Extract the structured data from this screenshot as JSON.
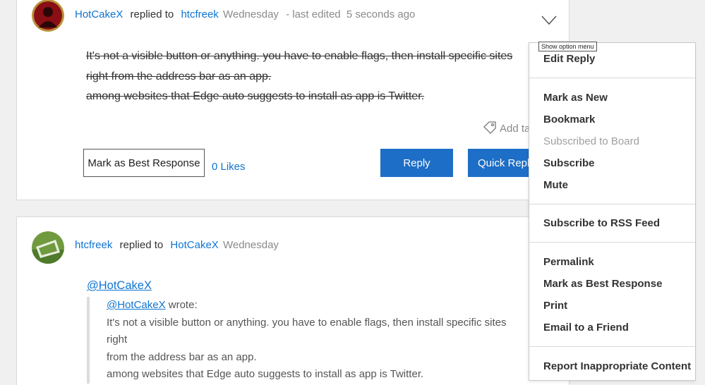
{
  "post1": {
    "author": "HotCakeX",
    "verb": "replied to",
    "reply_to": "htcfreek",
    "date": "Wednesday",
    "edited": "- last edited",
    "edited_time": "5 seconds ago",
    "body_lines": [
      "It's not a visible button or anything. you have to enable flags, then install specific sites",
      "right from the address bar as an app.",
      "among websites that Edge auto suggests to install as app is Twitter."
    ],
    "add_tag": "Add ta",
    "mark_best": "Mark as Best Response",
    "likes": "0 Likes",
    "reply": "Reply",
    "quick_reply": "Quick Reply"
  },
  "post2": {
    "author": "htcfreek",
    "verb": "replied to",
    "reply_to": "HotCakeX",
    "date": "Wednesday",
    "mention": "@HotCakeX",
    "quote_author": "@HotCakeX",
    "quote_wrote": "wrote:",
    "quote_lines": [
      "It's not a visible button or anything. you have to enable flags, then install specific sites right",
      "from the address bar as an app.",
      "among websites that Edge auto suggests to install as app is Twitter."
    ]
  },
  "tooltip": "Show option menu",
  "menu": {
    "items": [
      {
        "label": "Edit Reply",
        "disabled": false
      },
      {
        "label": "Mark as New",
        "disabled": false
      },
      {
        "label": "Bookmark",
        "disabled": false
      },
      {
        "label": "Subscribed to Board",
        "disabled": true
      },
      {
        "label": "Subscribe",
        "disabled": false
      },
      {
        "label": "Mute",
        "disabled": false
      },
      {
        "label": "Subscribe to RSS Feed",
        "disabled": false
      },
      {
        "label": "Permalink",
        "disabled": false
      },
      {
        "label": "Mark as Best Response",
        "disabled": false
      },
      {
        "label": "Print",
        "disabled": false
      },
      {
        "label": "Email to a Friend",
        "disabled": false
      },
      {
        "label": "Report Inappropriate Content",
        "disabled": false
      }
    ]
  },
  "colors": {
    "link": "#0f74d1",
    "button_blue": "#1d6ec6",
    "disabled": "#a0a0a0"
  },
  "icons": [
    "chevron-down-icon",
    "tag-icon"
  ]
}
